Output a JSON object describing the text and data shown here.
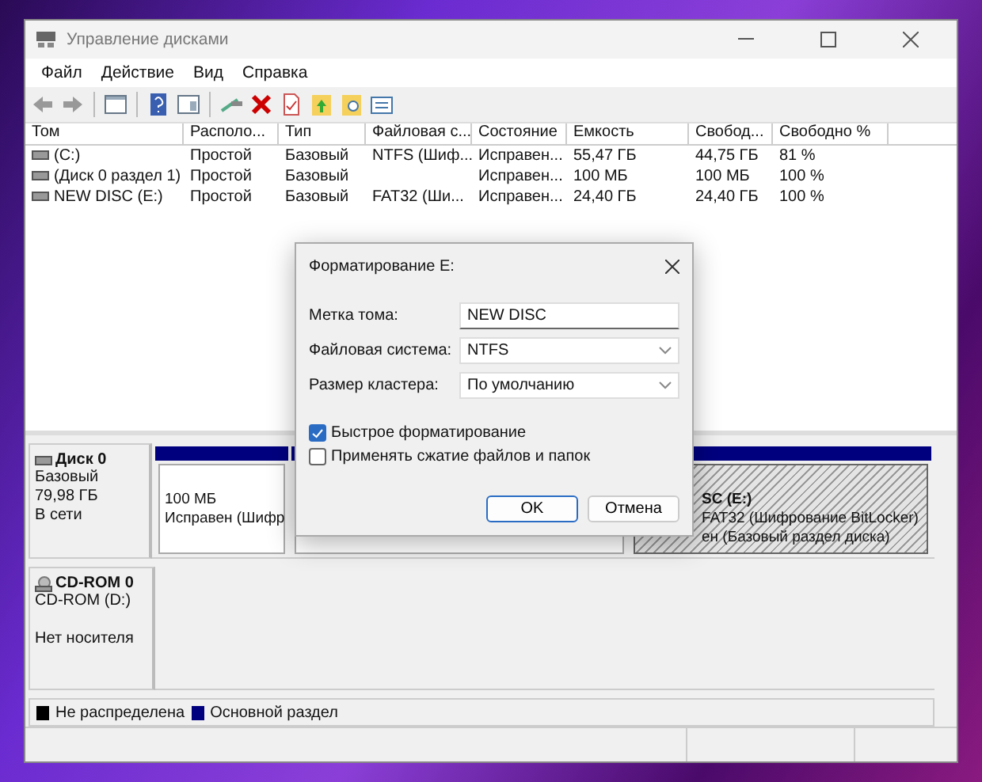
{
  "window": {
    "title": "Управление дисками"
  },
  "menu": [
    {
      "label": "Файл"
    },
    {
      "label": "Действие"
    },
    {
      "label": "Вид"
    },
    {
      "label": "Справка"
    }
  ],
  "table": {
    "columns": [
      "Том",
      "Располо...",
      "Тип",
      "Файловая с...",
      "Состояние",
      "Емкость",
      "Свобод...",
      "Свободно %"
    ],
    "rows": [
      [
        "(C:)",
        "Простой",
        "Базовый",
        "NTFS (Шиф...",
        "Исправен...",
        "55,47 ГБ",
        "44,75 ГБ",
        "81 %"
      ],
      [
        "(Диск 0 раздел 1)",
        "Простой",
        "Базовый",
        "",
        "Исправен...",
        "100 МБ",
        "100 МБ",
        "100 %"
      ],
      [
        "NEW DISC (E:)",
        "Простой",
        "Базовый",
        "FAT32 (Ши...",
        "Исправен...",
        "24,40 ГБ",
        "24,40 ГБ",
        "100 %"
      ]
    ]
  },
  "disks": [
    {
      "kind": "disk",
      "name": "Диск 0",
      "type": "Базовый",
      "size": "79,98 ГБ",
      "status": "В сети",
      "partitions": [
        {
          "selected": false,
          "lines": [
            "100 МБ",
            "Исправен (Шифр"
          ]
        },
        {
          "selected": false
        },
        {
          "selected": true,
          "title": "SC  (E:)",
          "lines": [
            "FAT32 (Шифрование BitLocker)",
            "ен (Базовый раздел диска)"
          ]
        }
      ]
    },
    {
      "kind": "cdrom",
      "name": "CD-ROM 0",
      "type": "CD-ROM (D:)",
      "status": "Нет носителя"
    }
  ],
  "legend": [
    {
      "label": "Не распределена",
      "color": "#000000"
    },
    {
      "label": "Основной раздел",
      "color": "#00007f"
    }
  ],
  "dialog": {
    "title": "Форматирование E:",
    "fields": [
      {
        "kind": "text",
        "label": "Метка тома:",
        "value": "NEW DISC"
      },
      {
        "kind": "select",
        "label": "Файловая система:",
        "value": "NTFS"
      },
      {
        "kind": "select",
        "label": "Размер кластера:",
        "value": "По умолчанию"
      }
    ],
    "options": [
      {
        "label": "Быстрое форматирование",
        "checked": true
      },
      {
        "label": "Применять сжатие файлов и папок",
        "checked": false
      }
    ],
    "buttons": [
      {
        "label": "OK",
        "primary": true
      },
      {
        "label": "Отмена",
        "primary": false
      }
    ]
  }
}
